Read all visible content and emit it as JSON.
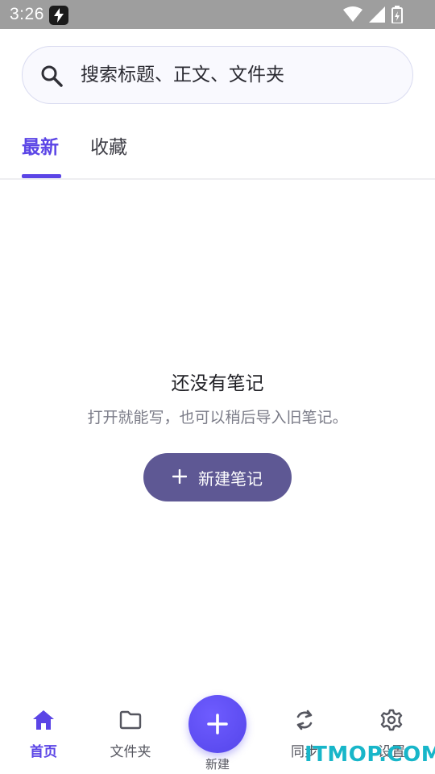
{
  "status_bar": {
    "time": "3:26"
  },
  "search": {
    "placeholder": "搜索标题、正文、文件夹"
  },
  "tabs": [
    {
      "label": "最新",
      "active": true
    },
    {
      "label": "收藏",
      "active": false
    }
  ],
  "empty_state": {
    "title": "还没有笔记",
    "subtitle": "打开就能写，也可以稍后导入旧笔记。",
    "button_label": "新建笔记",
    "button_icon": "plus-icon"
  },
  "bottom_nav": {
    "home": {
      "label": "首页",
      "icon": "home-icon",
      "active": true
    },
    "folder": {
      "label": "文件夹",
      "icon": "folder-icon"
    },
    "new": {
      "label": "新建",
      "icon": "plus-icon"
    },
    "sync": {
      "label": "同步",
      "icon": "sync-icon"
    },
    "settings": {
      "label": "设置",
      "icon": "gear-icon"
    }
  },
  "watermark": "ITMOP.COM",
  "colors": {
    "accent": "#5b45e6",
    "button": "#5e5894",
    "status_bar": "#9e9e9e",
    "watermark": "#18b6c9"
  }
}
